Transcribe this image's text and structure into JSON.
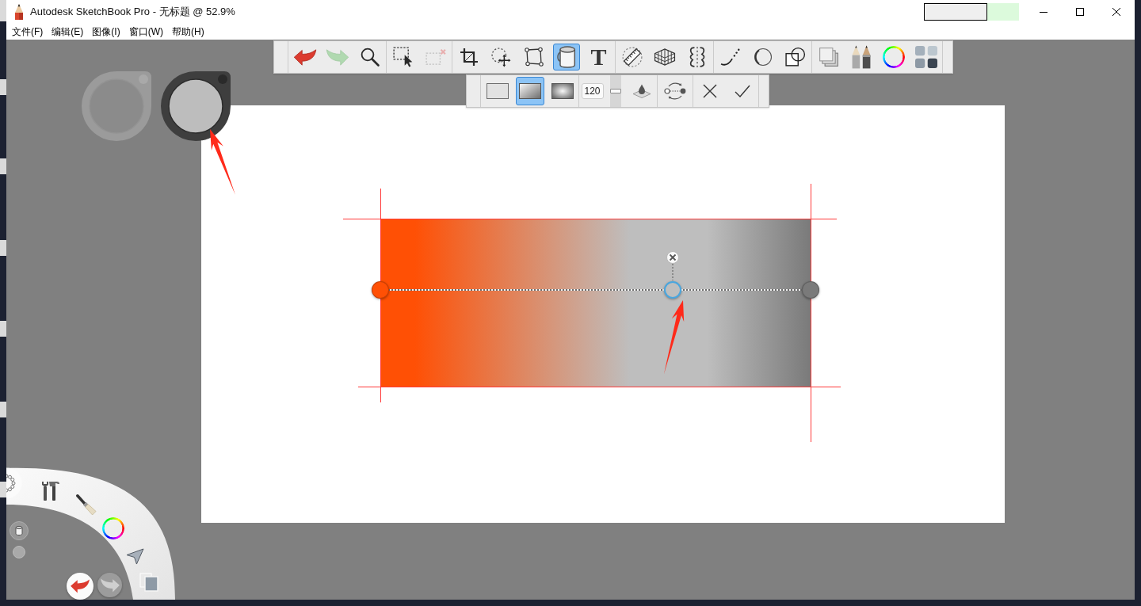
{
  "window": {
    "title": "Autodesk SketchBook Pro - 无标题 @ 52.9%"
  },
  "menu": [
    {
      "label": "文件(F)"
    },
    {
      "label": "编辑(E)"
    },
    {
      "label": "图像(I)"
    },
    {
      "label": "窗口(W)"
    },
    {
      "label": "帮助(H)"
    }
  ],
  "toolbar": {
    "groups": [
      {
        "tools": [
          {
            "kind": "undo",
            "selected": false,
            "disabled": false
          },
          {
            "kind": "redo",
            "selected": false,
            "disabled": true
          },
          {
            "kind": "zoom",
            "selected": false,
            "disabled": false
          }
        ]
      },
      {
        "tools": [
          {
            "kind": "select",
            "selected": false,
            "disabled": false
          },
          {
            "kind": "deselect",
            "selected": false,
            "disabled": true
          }
        ]
      },
      {
        "tools": [
          {
            "kind": "crop",
            "selected": false,
            "disabled": false
          },
          {
            "kind": "transform",
            "selected": false,
            "disabled": false
          },
          {
            "kind": "distort",
            "selected": false,
            "disabled": false
          },
          {
            "kind": "fill",
            "selected": true,
            "disabled": false
          },
          {
            "kind": "text",
            "glyph": "T",
            "selected": false,
            "disabled": false
          }
        ]
      },
      {
        "tools": [
          {
            "kind": "ruler",
            "selected": false,
            "disabled": false
          },
          {
            "kind": "perspective",
            "selected": false,
            "disabled": false
          },
          {
            "kind": "symmetry",
            "selected": false,
            "disabled": false
          }
        ]
      },
      {
        "tools": [
          {
            "kind": "stroke",
            "selected": false,
            "disabled": false
          },
          {
            "kind": "ellipse",
            "selected": false,
            "disabled": false
          },
          {
            "kind": "shapes",
            "selected": false,
            "disabled": false
          }
        ]
      },
      {
        "tools": [
          {
            "kind": "layers",
            "selected": false,
            "disabled": false
          },
          {
            "kind": "brushes",
            "selected": false,
            "disabled": false
          },
          {
            "kind": "color",
            "selected": false,
            "disabled": false
          },
          {
            "kind": "palette",
            "selected": false,
            "disabled": false
          }
        ]
      }
    ]
  },
  "fill_options": {
    "modes": [
      {
        "kind": "solid",
        "selected": false
      },
      {
        "kind": "linear",
        "selected": true
      },
      {
        "kind": "radial",
        "selected": false
      }
    ],
    "tolerance": {
      "value": "120",
      "level": 0.5
    }
  },
  "gradient": {
    "stops": [
      {
        "color": "#ff5005",
        "level": 0,
        "selected": false
      },
      {
        "color": "#bebebe",
        "level": 0.68,
        "selected": true
      },
      {
        "color": "#7a7a7a",
        "level": 1,
        "selected": false
      }
    ]
  },
  "lagoon": {
    "history": [
      {
        "kind": "undo",
        "disabled": false
      },
      {
        "kind": "redo",
        "disabled": true
      }
    ]
  }
}
